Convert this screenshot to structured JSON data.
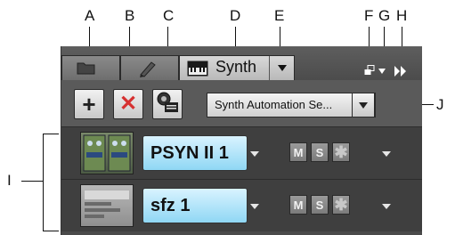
{
  "callouts": [
    "A",
    "B",
    "C",
    "D",
    "E",
    "F",
    "G",
    "H",
    "I",
    "J"
  ],
  "tabs": {
    "active_label": "Synth"
  },
  "toolbar": {
    "preset_label": "Synth Automation Se..."
  },
  "synths": [
    {
      "name": "PSYN II 1",
      "mute": "M",
      "solo": "S",
      "thumb_icon": "psyn-thumbnail-icon"
    },
    {
      "name": "sfz 1",
      "mute": "M",
      "solo": "S",
      "thumb_icon": "sfz-thumbnail-icon"
    }
  ],
  "icons": [
    "folder-icon",
    "pen-icon",
    "keyboard-icon",
    "chevron-down-icon",
    "layout-icon",
    "double-arrow-icon",
    "plus-icon",
    "x-icon",
    "properties-icon",
    "asterisk-icon"
  ],
  "colors": {
    "delete_red": "#d63030",
    "name_blue": "#a6def6",
    "panel_bg": "#4a4a4a"
  }
}
